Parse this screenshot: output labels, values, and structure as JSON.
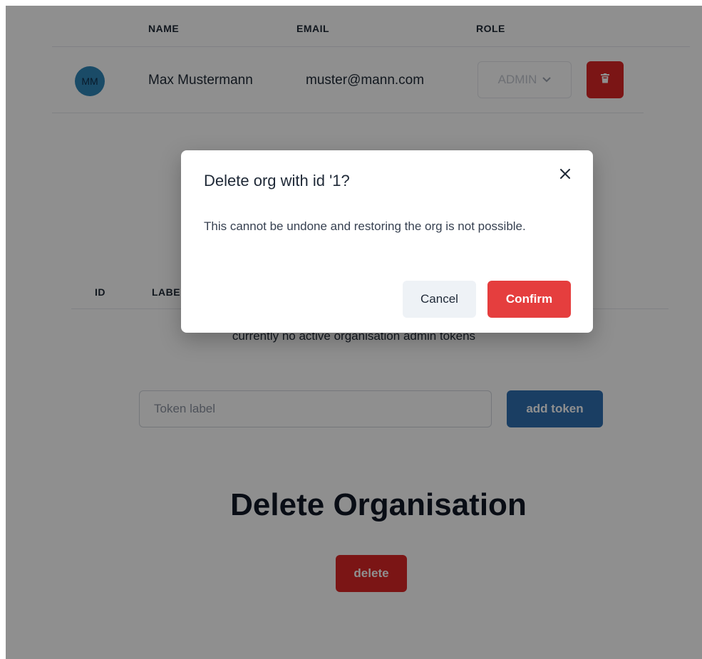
{
  "members_table": {
    "headers": {
      "name": "NAME",
      "email": "EMAIL",
      "role": "ROLE"
    },
    "rows": [
      {
        "initials": "MM",
        "name": "Max Mustermann",
        "email": "muster@mann.com",
        "role": "ADMIN"
      }
    ]
  },
  "tokens": {
    "headers": {
      "id": "ID",
      "label": "LABEL"
    },
    "empty_text": "currently no active organisation admin tokens",
    "input_placeholder": "Token label",
    "add_button": "add token"
  },
  "delete_section": {
    "title": "Delete Organisation",
    "button": "delete"
  },
  "modal": {
    "title": "Delete org with id '1?",
    "body": "This cannot be undone and restoring the org is not possible.",
    "cancel": "Cancel",
    "confirm": "Confirm"
  },
  "colors": {
    "danger": "#dc2626",
    "primary": "#2f6fb0",
    "avatar": "#2f86b8"
  }
}
